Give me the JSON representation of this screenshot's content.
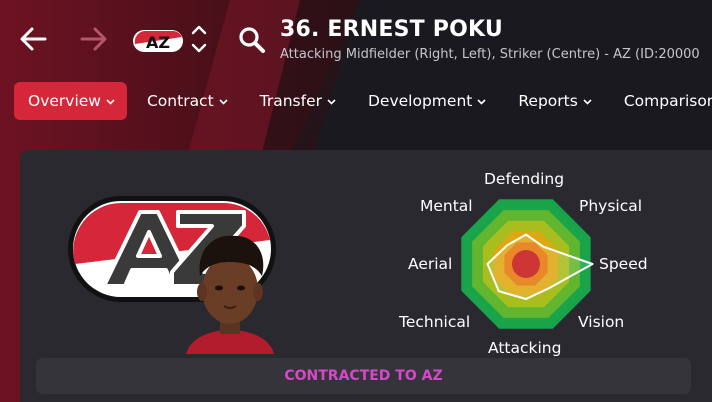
{
  "header": {
    "title": "36. ERNEST POKU",
    "subtitle": "Attacking Midfielder (Right, Left), Striker (Centre) - AZ (ID:20000",
    "club_badge_text": "AZ",
    "icons": {
      "back": "arrow-left-icon",
      "forward": "arrow-right-icon",
      "switch": "chevron-up-down-icon",
      "search": "search-icon"
    }
  },
  "tabs": [
    {
      "label": "Overview",
      "active": true
    },
    {
      "label": "Contract"
    },
    {
      "label": "Transfer"
    },
    {
      "label": "Development"
    },
    {
      "label": "Reports"
    },
    {
      "label": "Comparison"
    }
  ],
  "radar": {
    "labels": {
      "top": "Defending",
      "top_right": "Physical",
      "right": "Speed",
      "bottom_right": "Vision",
      "bottom": "Attacking",
      "bottom_left": "Technical",
      "left": "Aerial",
      "top_left": "Mental"
    },
    "axes_order": [
      "Defending",
      "Physical",
      "Speed",
      "Vision",
      "Attacking",
      "Technical",
      "Aerial",
      "Mental"
    ],
    "values": [
      0.42,
      0.35,
      0.95,
      0.48,
      0.5,
      0.55,
      0.55,
      0.38
    ],
    "ring_colors": [
      "#19a44a",
      "#62b52f",
      "#a8bd1e",
      "#dfa812",
      "#e5780e",
      "#d31f1f"
    ]
  },
  "footer": {
    "status": "CONTRACTED TO AZ"
  },
  "colors": {
    "accent": "#d5263a",
    "status_text": "#d648c9",
    "panel": "#2a2930"
  }
}
